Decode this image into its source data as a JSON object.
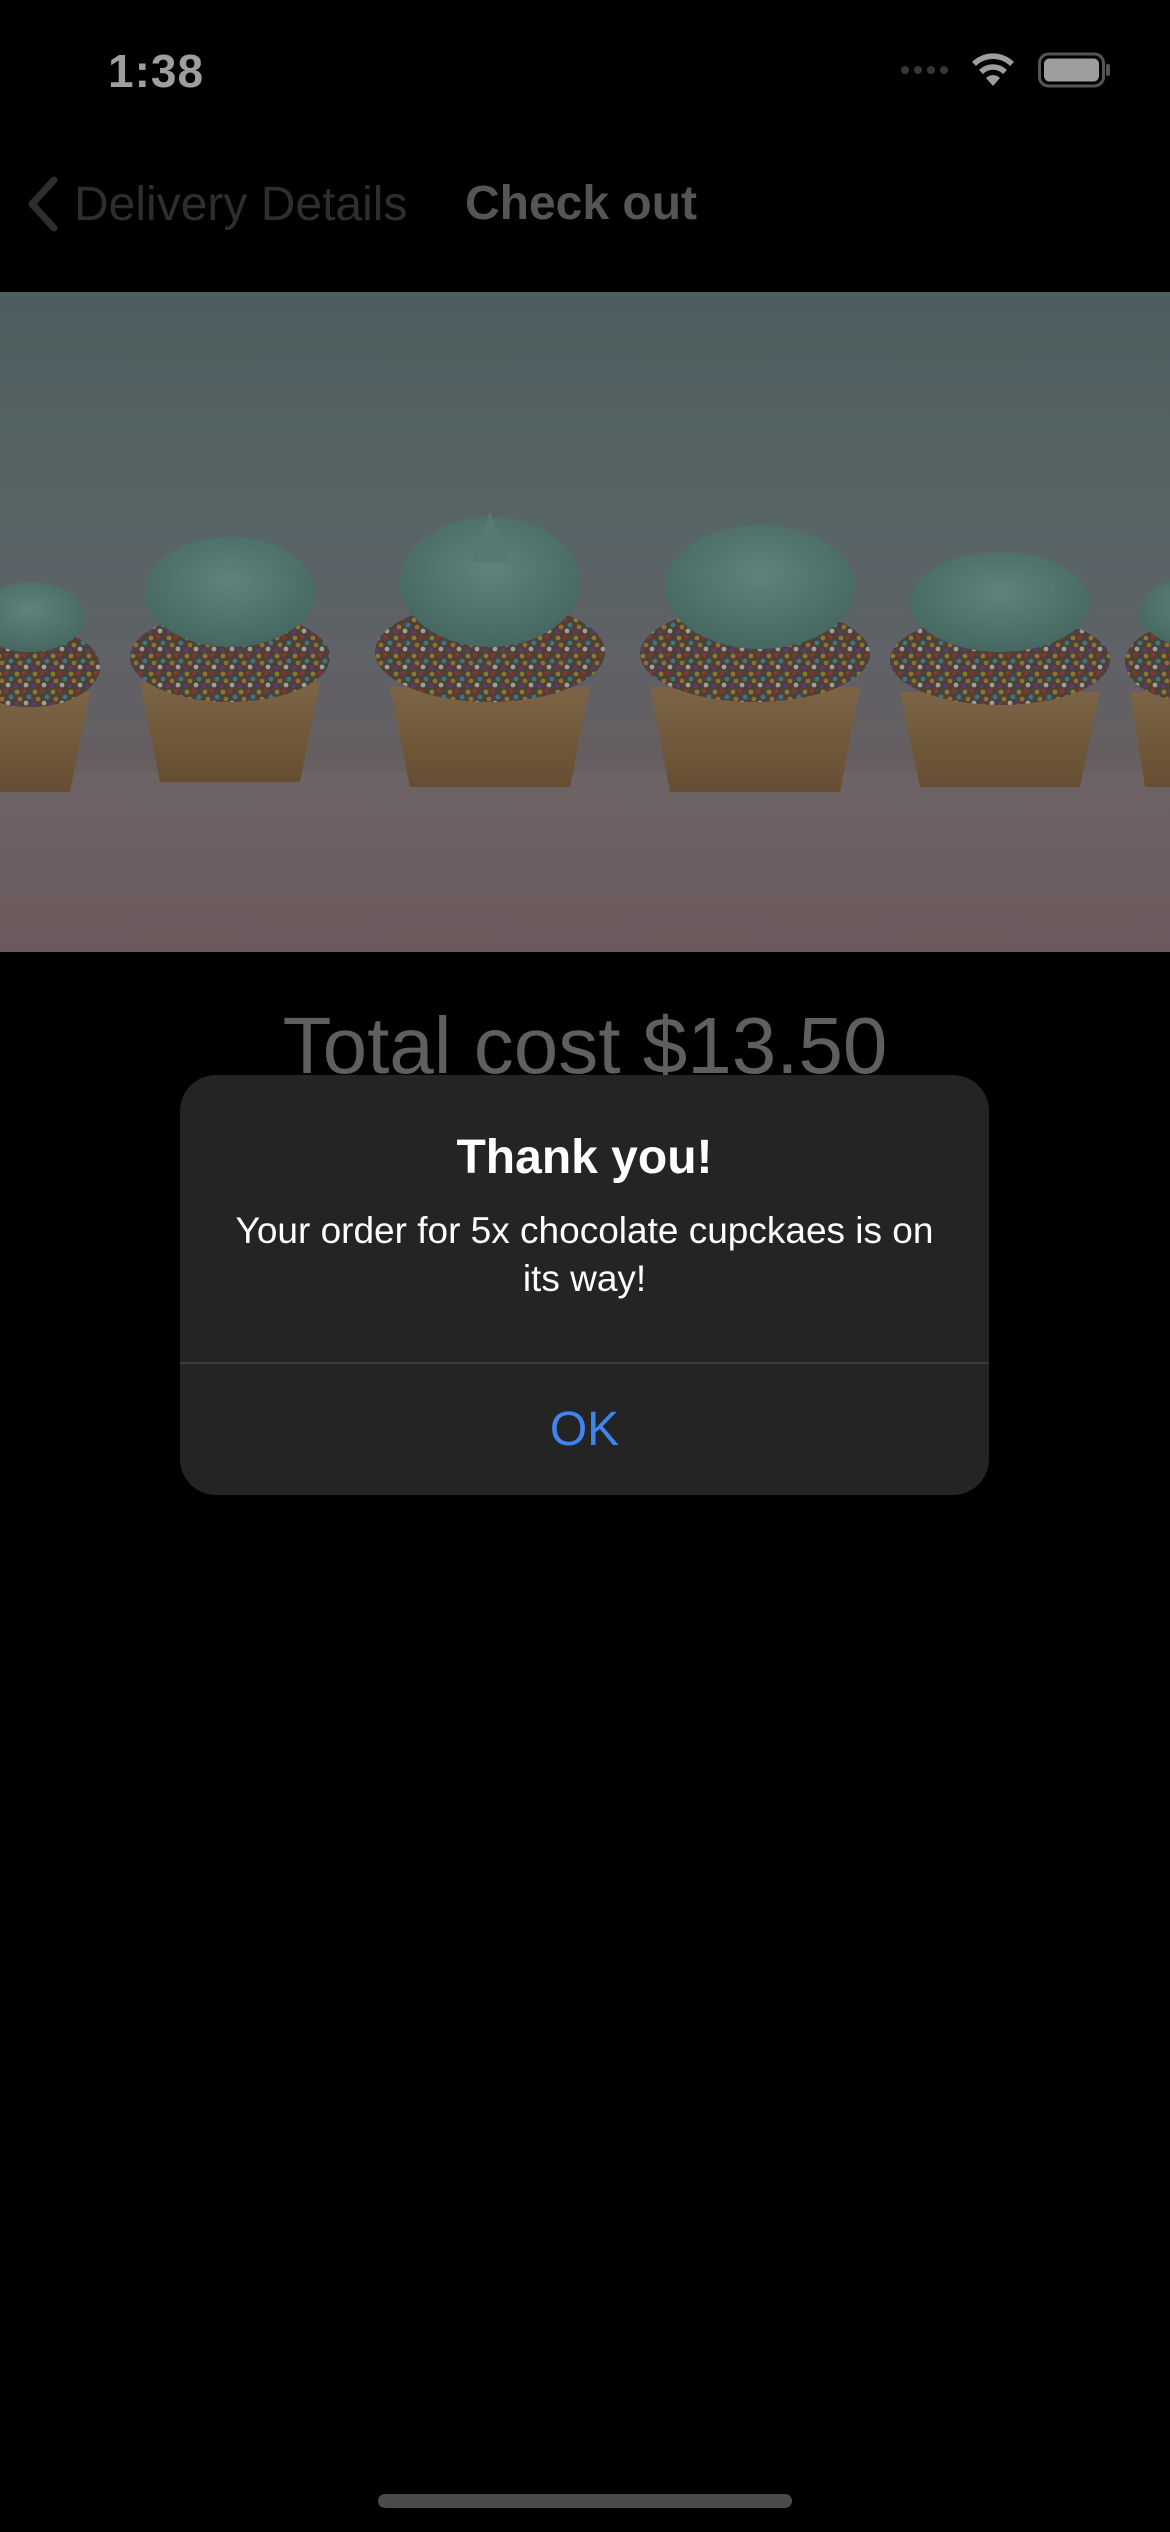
{
  "status_bar": {
    "time": "1:38"
  },
  "nav": {
    "back_label": "Delivery Details",
    "title": "Check out"
  },
  "hero": {
    "image_icon": "cupcakes-photo"
  },
  "content": {
    "total_cost": "Total cost $13.50"
  },
  "alert": {
    "title": "Thank you!",
    "message": "Your order for 5x chocolate cupckaes is on its way!",
    "ok_label": "OK"
  },
  "colors": {
    "accent": "#3f85f0",
    "background": "#000000",
    "alert_background": "#242424"
  }
}
